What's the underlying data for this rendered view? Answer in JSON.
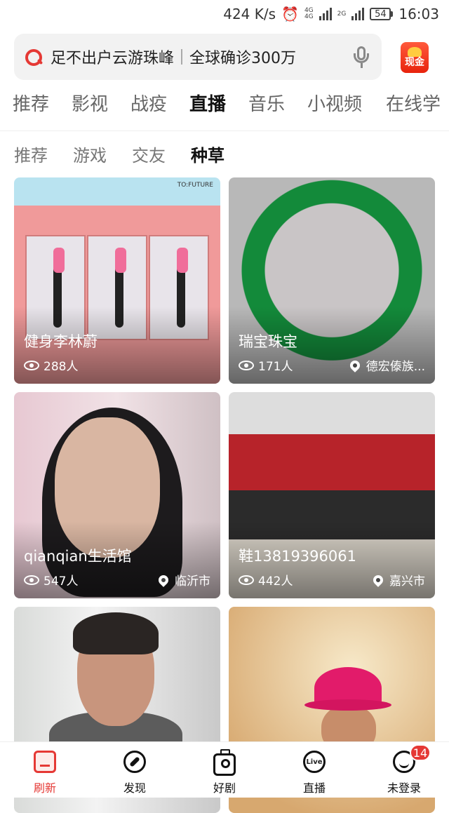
{
  "status_bar": {
    "speed": "424 K/s",
    "network_top": "4G",
    "network_bottom": "4G",
    "network2": "2G",
    "battery": "54",
    "time": "16:03"
  },
  "search": {
    "query1": "足不出户云游珠峰",
    "query2": "全球确诊300万",
    "cash_label": "现金"
  },
  "tabs": [
    {
      "label": "推荐",
      "active": false
    },
    {
      "label": "影视",
      "active": false
    },
    {
      "label": "战疫",
      "active": false
    },
    {
      "label": "直播",
      "active": true
    },
    {
      "label": "音乐",
      "active": false
    },
    {
      "label": "小视频",
      "active": false
    },
    {
      "label": "在线学",
      "active": false
    }
  ],
  "subtabs": [
    {
      "label": "推荐",
      "active": false
    },
    {
      "label": "游戏",
      "active": false
    },
    {
      "label": "交友",
      "active": false
    },
    {
      "label": "种草",
      "active": true
    }
  ],
  "cards": [
    {
      "title": "健身李林蔚",
      "viewers": "288人",
      "location": "",
      "art_label": "TO:FUTURE"
    },
    {
      "title": "瑞宝珠宝",
      "viewers": "171人",
      "location": "德宏傣族..."
    },
    {
      "title": "qianqian生活馆",
      "viewers": "547人",
      "location": "临沂市"
    },
    {
      "title": "鞋13819396061",
      "viewers": "442人",
      "location": "嘉兴市"
    },
    {
      "title": "",
      "viewers": "",
      "location": ""
    },
    {
      "title": "",
      "viewers": "",
      "location": ""
    }
  ],
  "bottom_nav": [
    {
      "label": "刷新",
      "icon": "home-icon",
      "active": true
    },
    {
      "label": "发现",
      "icon": "compass-icon",
      "active": false
    },
    {
      "label": "好剧",
      "icon": "tv-icon",
      "active": false
    },
    {
      "label": "直播",
      "icon": "live-icon",
      "icon_text": "Live",
      "active": false
    },
    {
      "label": "未登录",
      "icon": "user-icon",
      "active": false,
      "badge": "14"
    }
  ],
  "colors": {
    "accent": "#e53935"
  }
}
